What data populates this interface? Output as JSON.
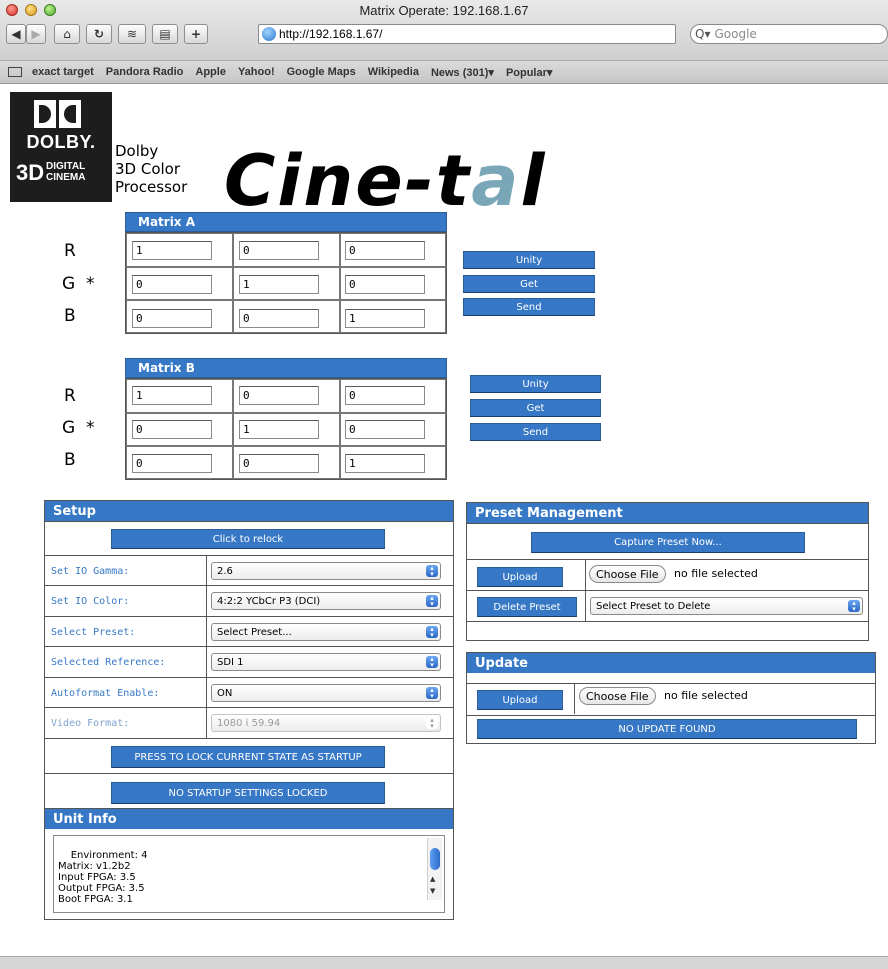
{
  "window": {
    "title": "Matrix Operate: 192.168.1.67"
  },
  "toolbar": {
    "url": "http://192.168.1.67/",
    "search_placeholder": "Google",
    "back_icon": "back-arrow-icon",
    "forward_icon": "forward-arrow-icon",
    "home_icon": "home-icon",
    "reload_icon": "reload-icon",
    "add_icon": "plus-icon"
  },
  "bookmarks": [
    "exact target",
    "Pandora Radio",
    "Apple",
    "Yahoo!",
    "Google Maps",
    "Wikipedia",
    "News (301)▾",
    "Popular▾"
  ],
  "branding": {
    "dolby_word": "DOLBY.",
    "dolby_3d": "3D",
    "dolby_dc": "DIGITAL\nCINEMA",
    "desc_line1": "Dolby",
    "desc_line2": "3D Color",
    "desc_line3": "Processor",
    "cinetal_main": "Cine-t",
    "cinetal_accent": "a",
    "cinetal_end": "l"
  },
  "matrix_a": {
    "title": "Matrix A",
    "rows": [
      {
        "label": "R",
        "values": [
          "1",
          "0",
          "0"
        ]
      },
      {
        "label": "G  *",
        "values": [
          "0",
          "1",
          "0"
        ]
      },
      {
        "label": "B",
        "values": [
          "0",
          "0",
          "1"
        ]
      }
    ],
    "buttons": {
      "unity": "Unity",
      "get": "Get",
      "send": "Send"
    }
  },
  "matrix_b": {
    "title": "Matrix B",
    "rows": [
      {
        "label": "R",
        "values": [
          "1",
          "0",
          "0"
        ]
      },
      {
        "label": "G  *",
        "values": [
          "0",
          "1",
          "0"
        ]
      },
      {
        "label": "B",
        "values": [
          "0",
          "0",
          "1"
        ]
      }
    ],
    "buttons": {
      "unity": "Unity",
      "get": "Get",
      "send": "Send"
    }
  },
  "setup": {
    "title": "Setup",
    "relock_button": "Click to relock",
    "rows": [
      {
        "label": "Set IO Gamma:",
        "value": "2.6"
      },
      {
        "label": "Set IO Color:",
        "value": "4:2:2 YCbCr P3 (DCI)"
      },
      {
        "label": "Select Preset:",
        "value": "Select Preset..."
      },
      {
        "label": "Selected Reference:",
        "value": "SDI 1"
      },
      {
        "label": "Autoformat Enable:",
        "value": "ON"
      },
      {
        "label": "Video Format:",
        "value": "1080 i 59.94"
      }
    ],
    "lock_startup_button": "PRESS TO LOCK CURRENT STATE AS STARTUP",
    "startup_status_button": "NO STARTUP SETTINGS LOCKED"
  },
  "unit_info": {
    "title": "Unit Info",
    "text": "Environment: 4\nMatrix: v1.2b2\nInput FPGA: 3.5\nOutput FPGA: 3.5\nBoot FPGA: 3.1"
  },
  "preset_management": {
    "title": "Preset Management",
    "capture_button": "Capture Preset Now...",
    "upload_button": "Upload",
    "choose_file": "Choose File",
    "file_status": "no file selected",
    "delete_button": "Delete Preset",
    "delete_select": "Select Preset to Delete"
  },
  "update": {
    "title": "Update",
    "upload_button": "Upload",
    "choose_file": "Choose File",
    "file_status": "no file selected",
    "status_button": "NO UPDATE FOUND"
  },
  "colors": {
    "accent_blue": "#3778c6",
    "label_blue": "#3778c6"
  }
}
